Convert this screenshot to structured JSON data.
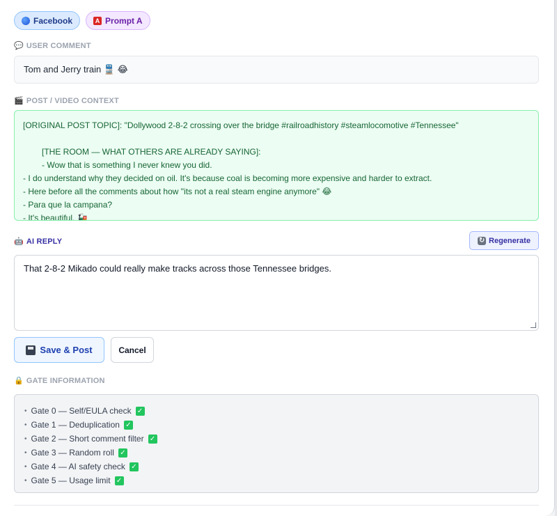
{
  "chips": {
    "platform": "Facebook",
    "prompt": "Prompt A",
    "prompt_badge": "A"
  },
  "user_comment": {
    "label": "USER COMMENT",
    "icon": "speech-bubble-icon",
    "text": "Tom and Jerry train 🚆 😂"
  },
  "context": {
    "label": "POST / VIDEO CONTEXT",
    "icon": "clapper-icon",
    "lines": [
      "[ORIGINAL POST TOPIC]: \"Dollywood 2-8-2 crossing over the bridge  #railroadhistory #steamlocomotive #Tennessee\"",
      "",
      "[THE ROOM — WHAT OTHERS ARE ALREADY SAYING]:",
      "- Wow that is something I never knew you did.",
      "- I do understand why they decided on oil. It's because coal is becoming more expensive and harder to extract.",
      "- Here before all the comments about how \"its not a real steam engine anymore\" 😂",
      "- Para que la campana?",
      "- It's beautiful. 🚂"
    ]
  },
  "ai_reply": {
    "label": "AI REPLY",
    "icon": "robot-icon",
    "regenerate_label": "Regenerate",
    "text": "That 2-8-2 Mikado could really make tracks across those Tennessee bridges."
  },
  "actions": {
    "save_label": "Save & Post",
    "cancel_label": "Cancel"
  },
  "gates": {
    "label": "GATE INFORMATION",
    "icon": "lock-icon",
    "items": [
      "Gate 0 — Self/EULA check",
      "Gate 1 — Deduplication",
      "Gate 2 — Short comment filter",
      "Gate 3 — Random roll",
      "Gate 4 — AI safety check",
      "Gate 5 — Usage limit"
    ],
    "status_icon": "check-mark-icon"
  },
  "colors": {
    "context_bg": "#ecfdf3",
    "context_text": "#166534",
    "accent": "#3730a3",
    "check": "#22c55e"
  }
}
